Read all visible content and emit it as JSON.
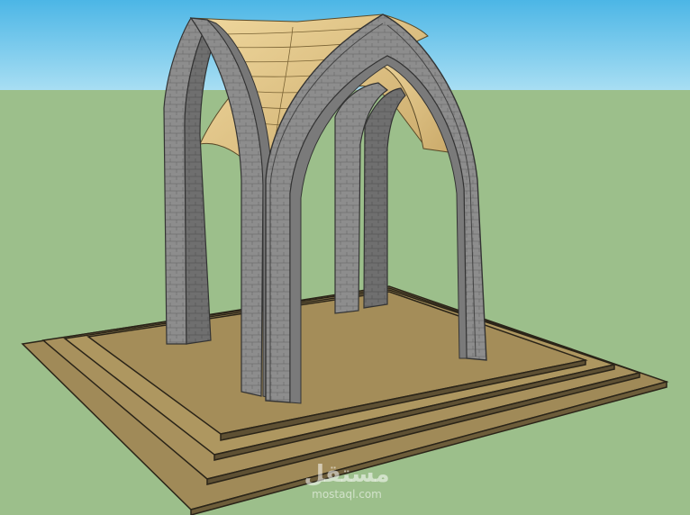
{
  "watermark": {
    "logo": "مستقل",
    "site": "mostaql.com"
  },
  "colors": {
    "sky": "#5dc1ea",
    "ground": "#9cbf8b",
    "platform": "#a08a58",
    "stone": "#8f8f8f",
    "vault": "#e3c98a"
  }
}
